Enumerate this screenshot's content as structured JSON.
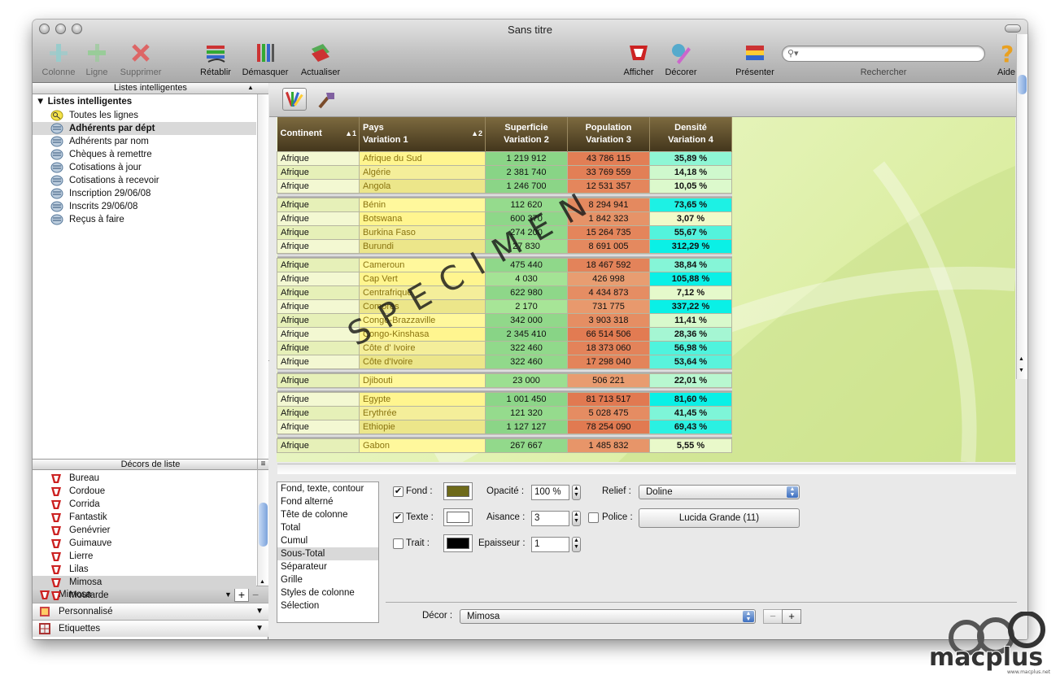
{
  "window": {
    "title": "Sans titre"
  },
  "toolbar": {
    "colonne": "Colonne",
    "ligne": "Ligne",
    "supprimer": "Supprimer",
    "retablir": "Rétablir",
    "demasquer": "Démasquer",
    "actualiser": "Actualiser",
    "afficher": "Afficher",
    "decorer": "Décorer",
    "presenter": "Présenter",
    "rechercher": "Rechercher",
    "aide": "Aide",
    "search_placeholder": ""
  },
  "smart_lists": {
    "header": "Listes intelligentes",
    "group": "Listes intelligentes",
    "items": [
      {
        "label": "Toutes les lignes",
        "icon": "magnifier-icon"
      },
      {
        "label": "Adhérents par dépt",
        "icon": "smartlist-icon"
      },
      {
        "label": "Adhérents par nom",
        "icon": "smartlist-icon"
      },
      {
        "label": "Chèques à remettre",
        "icon": "smartlist-icon"
      },
      {
        "label": "Cotisations à jour",
        "icon": "smartlist-icon"
      },
      {
        "label": "Cotisations à recevoir",
        "icon": "smartlist-icon"
      },
      {
        "label": "Inscription 29/06/08",
        "icon": "smartlist-icon"
      },
      {
        "label": "Inscrits 29/06/08",
        "icon": "smartlist-icon"
      },
      {
        "label": "Reçus à faire",
        "icon": "smartlist-icon"
      }
    ],
    "selected_index": 1
  },
  "decors": {
    "header": "Décors de liste",
    "items": [
      "Bureau",
      "Cordoue",
      "Corrida",
      "Fantastik",
      "Genévrier",
      "Guimauve",
      "Lierre",
      "Lilas",
      "Mimosa",
      "Moutarde"
    ],
    "selected_index": 8
  },
  "bottom_bar": {
    "current": "Mimosa",
    "personnalise": "Personnalisé",
    "etiquettes": "Etiquettes"
  },
  "grid": {
    "headers": [
      {
        "line1": "Continent",
        "line2": "",
        "sort": "▲1"
      },
      {
        "line1": "Pays",
        "line2": "Variation 1",
        "sort": "▲2"
      },
      {
        "line1": "Superficie",
        "line2": "Variation 2",
        "sort": ""
      },
      {
        "line1": "Population",
        "line2": "Variation 3",
        "sort": ""
      },
      {
        "line1": "Densité",
        "line2": "Variation 4",
        "sort": ""
      }
    ],
    "groups": [
      [
        [
          "Afrique",
          "Afrique du Sud",
          "1 219 912",
          "43 786 115",
          "35,89 %"
        ],
        [
          "Afrique",
          "Algérie",
          "2 381 740",
          "33 769 559",
          "14,18 %"
        ],
        [
          "Afrique",
          "Angola",
          "1 246 700",
          "12 531 357",
          "10,05 %"
        ]
      ],
      [
        [
          "Afrique",
          "Bénin",
          "112 620",
          "8 294 941",
          "73,65 %"
        ],
        [
          "Afrique",
          "Botswana",
          "600 370",
          "1 842 323",
          "3,07 %"
        ],
        [
          "Afrique",
          "Burkina Faso",
          "274 200",
          "15 264 735",
          "55,67 %"
        ],
        [
          "Afrique",
          "Burundi",
          "27 830",
          "8 691 005",
          "312,29 %"
        ]
      ],
      [
        [
          "Afrique",
          "Cameroun",
          "475 440",
          "18 467 592",
          "38,84 %"
        ],
        [
          "Afrique",
          "Cap Vert",
          "4 030",
          "426 998",
          "105,88 %"
        ],
        [
          "Afrique",
          "Centrafrique",
          "622 980",
          "4 434 873",
          "7,12 %"
        ],
        [
          "Afrique",
          "Comores",
          "2 170",
          "731 775",
          "337,22 %"
        ],
        [
          "Afrique",
          "Congo-Brazzaville",
          "342 000",
          "3 903 318",
          "11,41 %"
        ],
        [
          "Afrique",
          "Congo-Kinshasa",
          "2 345 410",
          "66 514 506",
          "28,36 %"
        ],
        [
          "Afrique",
          "Côte d' Ivoire",
          "322 460",
          "18 373 060",
          "56,98 %"
        ],
        [
          "Afrique",
          "Côte d'Ivoire",
          "322 460",
          "17 298 040",
          "53,64 %"
        ]
      ],
      [
        [
          "Afrique",
          "Djibouti",
          "23 000",
          "506 221",
          "22,01 %"
        ]
      ],
      [
        [
          "Afrique",
          "Egypte",
          "1 001 450",
          "81 713 517",
          "81,60 %"
        ],
        [
          "Afrique",
          "Erythrée",
          "121 320",
          "5 028 475",
          "41,45 %"
        ],
        [
          "Afrique",
          "Ethiopie",
          "1 127 127",
          "78 254 090",
          "69,43 %"
        ]
      ],
      [
        [
          "Afrique",
          "Gabon",
          "267 667",
          "1 485 832",
          "5,55 %"
        ]
      ]
    ],
    "watermark": "SPECIMEN"
  },
  "style_panel": {
    "items": [
      "Fond, texte, contour",
      "Fond alterné",
      "Tête de colonne",
      "Total",
      "Cumul",
      "Sous-Total",
      "Séparateur",
      "Grille",
      "Styles de colonne",
      "Sélection"
    ],
    "selected_index": 5,
    "fond_label": "Fond :",
    "fond_checked": true,
    "fond_color": "#6e6a1a",
    "texte_label": "Texte :",
    "texte_checked": true,
    "texte_color": "#ffffff",
    "trait_label": "Trait :",
    "trait_checked": false,
    "trait_color": "#000000",
    "opacite_label": "Opacité :",
    "opacite_value": "100 %",
    "aisance_label": "Aisance :",
    "aisance_value": "3",
    "epaisseur_label": "Epaisseur :",
    "epaisseur_value": "1",
    "relief_label": "Relief :",
    "relief_value": "Doline",
    "police_label": "Police :",
    "police_value": "Lucida Grande (11)",
    "decor_label": "Décor :",
    "decor_value": "Mimosa"
  },
  "branding": {
    "logo": "macplus",
    "url": "www.macplus.net"
  }
}
